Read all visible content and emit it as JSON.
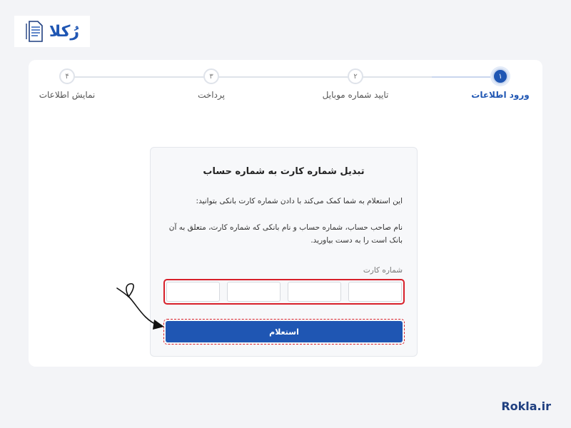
{
  "logo": {
    "text": "رُکلا",
    "icon": "document-icon"
  },
  "stepper": {
    "steps": [
      {
        "number": "۱",
        "label": "ورود اطلاعات",
        "active": true
      },
      {
        "number": "۲",
        "label": "تایید شماره موبایل",
        "active": false
      },
      {
        "number": "۳",
        "label": "پرداخت",
        "active": false
      },
      {
        "number": "۴",
        "label": "نمایش اطلاعات",
        "active": false
      }
    ]
  },
  "form": {
    "title": "تبدیل شماره کارت به شماره حساب",
    "description_1": "این استعلام به شما کمک می‌کند با دادن شماره کارت بانکی بتوانید:",
    "description_2": "نام صاحب حساب، شماره حساب و نام بانکی که شماره کارت، متعلق به آن بانک است را به دست بیاورید.",
    "card_label": "شماره کارت",
    "card_inputs": [
      "",
      "",
      "",
      ""
    ],
    "submit_label": "استعلام"
  },
  "footer": {
    "brand": "Rokla.ir"
  },
  "colors": {
    "primary": "#1f56b3",
    "highlight": "#d8202a",
    "background": "#f3f4f7"
  }
}
